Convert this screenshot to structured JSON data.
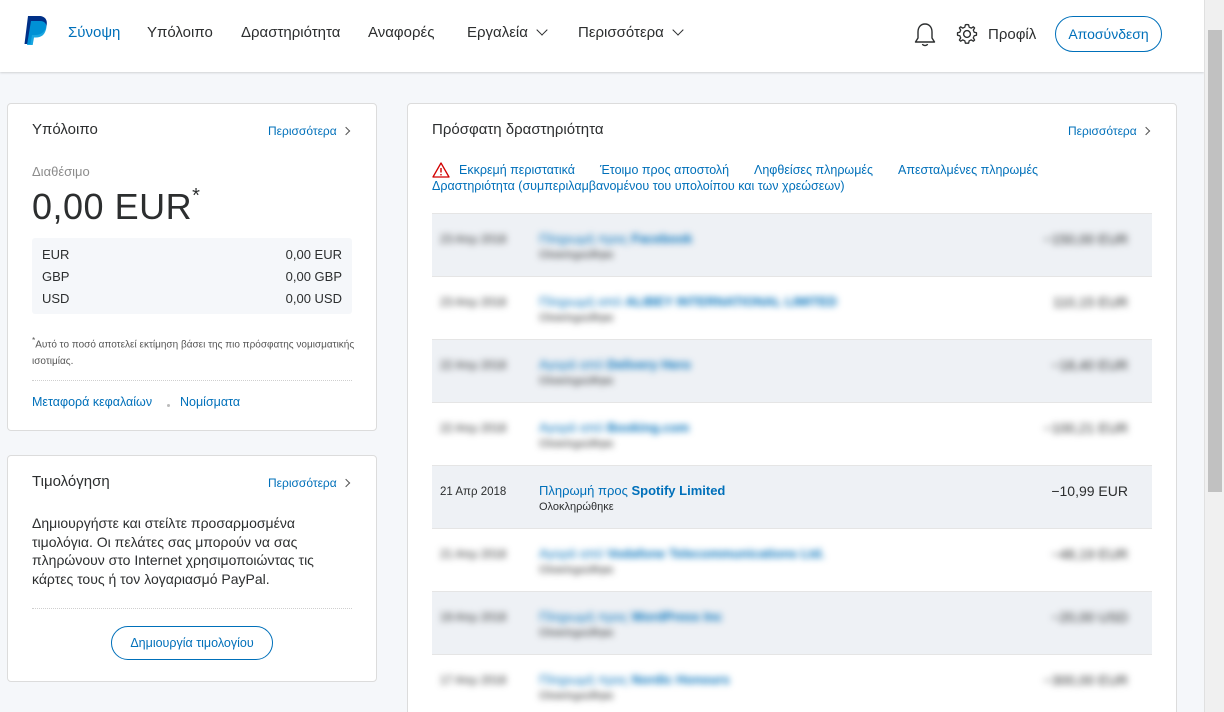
{
  "colors": {
    "brand_blue": "#0070ba",
    "paypal_dark": "#003087",
    "paypal_light": "#009cde",
    "warning_red": "#d20000"
  },
  "nav": {
    "items": [
      {
        "label": "Σύνοψη",
        "color": "#0070ba"
      },
      {
        "label": "Υπόλοιπο"
      },
      {
        "label": "Δραστηριότητα"
      },
      {
        "label": "Αναφορές"
      },
      {
        "label": "Εργαλεία"
      },
      {
        "label": "Περισσότερα"
      }
    ],
    "profile_label": "Προφίλ",
    "logout_label": "Αποσύνδεση",
    "icons": [
      "paypal-logo",
      "bell-icon",
      "gear-icon"
    ]
  },
  "balance": {
    "title": "Υπόλοιπο",
    "more_label": "Περισσότερα",
    "available_label": "Διαθέσιμο",
    "amount": "0,00 EUR",
    "asterisk": "*",
    "currencies": [
      {
        "code": "EUR",
        "amount": "0,00 EUR"
      },
      {
        "code": "GBP",
        "amount": "0,00 GBP"
      },
      {
        "code": "USD",
        "amount": "0,00 USD"
      }
    ],
    "footnote_mark": "*",
    "footnote": "Αυτό το ποσό αποτελεί εκτίμηση βάσει της πιο πρόσφατης νομισματικής ισοτιμίας.",
    "transfer_link": "Μεταφορά κεφαλαίων",
    "currencies_link": "Νομίσματα"
  },
  "invoicing": {
    "title": "Τιμολόγηση",
    "more_label": "Περισσότερα",
    "text": "Δημιουργήστε και στείλτε προσαρμοσμένα τιμολόγια. Οι πελάτες σας μπορούν να σας πληρώνουν στο Internet χρησιμοποιώντας τις κάρτες τους ή τον λογαριασμό PayPal.",
    "button_label": "Δημιουργία τιμολογίου"
  },
  "activity": {
    "title": "Πρόσφατη δραστηριότητα",
    "more_label": "Περισσότερα",
    "filters": {
      "pending": "Εκκρεμή περιστατικά",
      "ready_to_ship": "Έτοιμο προς αποστολή",
      "received": "Ληφθείσες πληρωμές",
      "sent": "Απεσταλμένες πληρωμές",
      "all": "Δραστηριότητα (συμπεριλαμβανομένου του υπολοίπου και των χρεώσεων)"
    },
    "rows": [
      {
        "date": "23 Απρ 2018",
        "prefix": "Πληρωμή προς",
        "name": "Facebook",
        "status": "Ολοκληρώθηκε",
        "amount": "−150,00 EUR",
        "blurred": true
      },
      {
        "date": "23 Απρ 2018",
        "prefix": "Πληρωμή από",
        "name": "ALIBEY INTERNATIONAL LIMITED",
        "status": "Ολοκληρώθηκε",
        "amount": "110,15 EUR",
        "blurred": true
      },
      {
        "date": "22 Απρ 2018",
        "prefix": "Αγορά από",
        "name": "Delivery Hero",
        "status": "Ολοκληρώθηκε",
        "amount": "−18,40 EUR",
        "blurred": true
      },
      {
        "date": "22 Απρ 2018",
        "prefix": "Αγορά από",
        "name": "Booking.com",
        "status": "Ολοκληρώθηκε",
        "amount": "−100,21 EUR",
        "blurred": true
      },
      {
        "date": "21 Απρ 2018",
        "prefix": "Πληρωμή προς",
        "name": "Spotify Limited",
        "status": "Ολοκληρώθηκε",
        "amount": "−10,99 EUR",
        "blurred": false
      },
      {
        "date": "21 Απρ 2018",
        "prefix": "Αγορά από",
        "name": "Vodafone Telecommunications Ltd.",
        "status": "Ολοκληρώθηκε",
        "amount": "−48,19 EUR",
        "blurred": true
      },
      {
        "date": "19 Απρ 2018",
        "prefix": "Πληρωμή προς",
        "name": "WordPress Inc",
        "status": "Ολοκληρώθηκε",
        "amount": "−20,00 USD",
        "blurred": true
      },
      {
        "date": "17 Απρ 2018",
        "prefix": "Πληρωμή προς",
        "name": "Nordic Honours",
        "status": "Ολοκληρώθηκε",
        "amount": "−300,00 EUR",
        "blurred": true
      }
    ]
  }
}
